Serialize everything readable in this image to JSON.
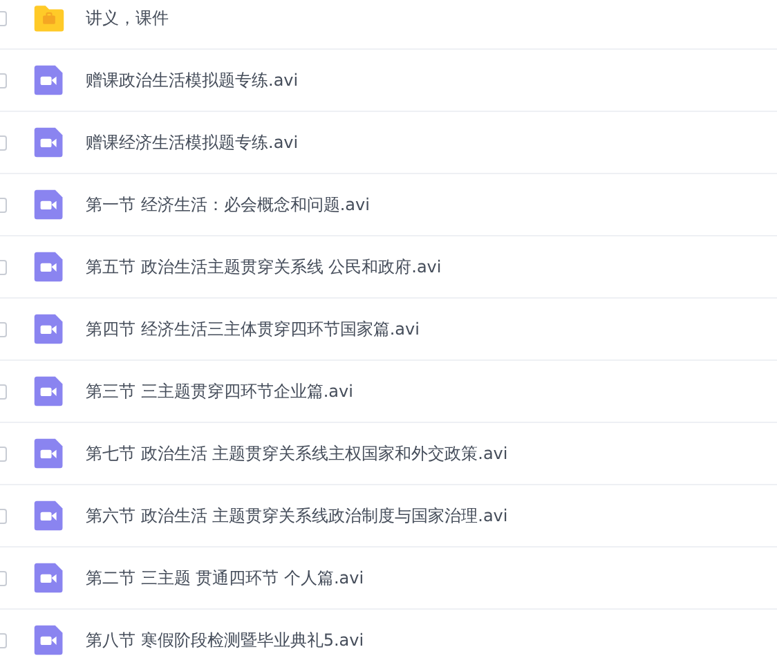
{
  "files": [
    {
      "kind": "folder",
      "name": "讲义，课件",
      "checked": false
    },
    {
      "kind": "video",
      "name": "赠课政治生活模拟题专练.avi",
      "checked": false
    },
    {
      "kind": "video",
      "name": "赠课经济生活模拟题专练.avi",
      "checked": false
    },
    {
      "kind": "video",
      "name": "第一节 经济生活：必会概念和问题.avi",
      "checked": false
    },
    {
      "kind": "video",
      "name": "第五节 政治生活主题贯穿关系线 公民和政府.avi",
      "checked": false
    },
    {
      "kind": "video",
      "name": "第四节 经济生活三主体贯穿四环节国家篇.avi",
      "checked": false
    },
    {
      "kind": "video",
      "name": "第三节 三主题贯穿四环节企业篇.avi",
      "checked": false
    },
    {
      "kind": "video",
      "name": "第七节 政治生活 主题贯穿关系线主权国家和外交政策.avi",
      "checked": false
    },
    {
      "kind": "video",
      "name": "第六节 政治生活 主题贯穿关系线政治制度与国家治理.avi",
      "checked": false
    },
    {
      "kind": "video",
      "name": "第二节 三主题 贯通四环节 个人篇.avi",
      "checked": false
    },
    {
      "kind": "video",
      "name": "第八节 寒假阶段检测暨毕业典礼5.avi",
      "checked": false
    }
  ]
}
